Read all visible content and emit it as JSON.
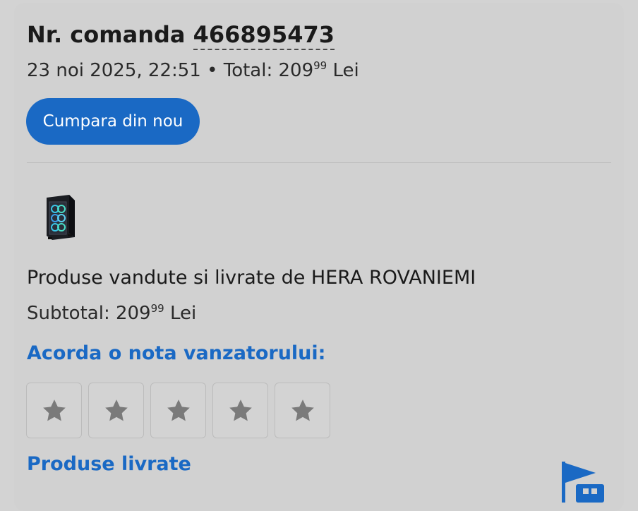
{
  "order": {
    "label": "Nr. comanda",
    "number": "466895473",
    "date": "23 noi 2025, 22:51",
    "separator": "•",
    "total_label": "Total:",
    "total_int": "209",
    "total_dec": "99",
    "currency": "Lei"
  },
  "buy_again": {
    "label": "Cumpara din nou"
  },
  "product": {
    "icon": "pc-case-icon"
  },
  "seller": {
    "line": "Produse vandute si livrate de HERA ROVANIEMI",
    "subtotal_label": "Subtotal:",
    "subtotal_int": "209",
    "subtotal_dec": "99",
    "currency": "Lei"
  },
  "rating": {
    "title": "Acorda o nota vanzatorului:",
    "stars": 5,
    "selected": 0
  },
  "delivered": {
    "title": "Produse livrate",
    "icon": "flag-icon"
  },
  "colors": {
    "accent": "#1a69c4",
    "background": "#d1d1d1",
    "star": "#7a7a7a"
  }
}
